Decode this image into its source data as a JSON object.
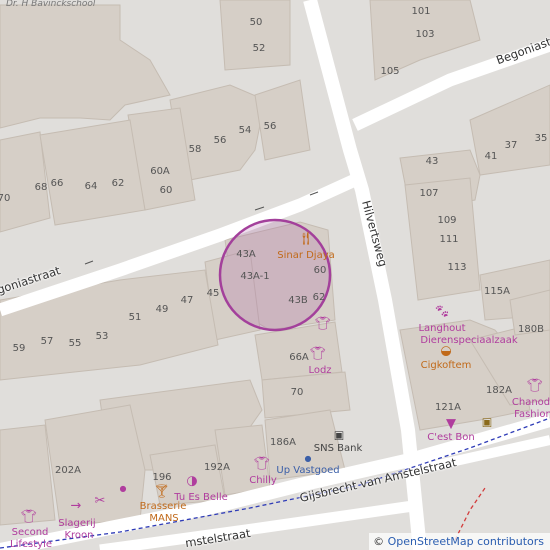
{
  "map": {
    "colors": {
      "background": "#e0dedb",
      "building": "#d6cfc7",
      "building_stroke": "#c5bcb2",
      "road": "#ffffff",
      "highlight_circle": "#a3409b",
      "poi_purple": "#b03d9e",
      "poi_orange": "#c16a1a",
      "route_blue": "#2f3cb7",
      "route_red": "#d23c3c"
    },
    "school_label": "Dr. H Bavinckschool",
    "streets": {
      "hilvertsweg": "Hilvertsweg",
      "begonia_top": "Begoniastr",
      "begonia_left": "goniastraat",
      "gijsbrecht": "Gijsbrecht van Amstelstraat",
      "amstel_bottom": "mstelstraat"
    },
    "house_numbers": {
      "n50": "50",
      "n52": "52",
      "n101": "101",
      "n103": "103",
      "n105": "105",
      "n54": "54",
      "n56a": "56",
      "n56b": "56",
      "n58": "58",
      "n60a": "60A",
      "n60": "60",
      "n62": "62",
      "n64": "64",
      "n66": "66",
      "n68": "68",
      "n70": "70",
      "n43": "43",
      "n41": "41",
      "n37": "37",
      "n35": "35",
      "n107": "107",
      "n109": "109",
      "n111": "111",
      "n113": "113",
      "n115a": "115A",
      "n43a": "43A",
      "n43a1": "43A-1",
      "n60b": "60",
      "n43b": "43B",
      "n62b": "62",
      "n45": "45",
      "n47": "47",
      "n49": "49",
      "n51": "51",
      "n53": "53",
      "n55": "55",
      "n57": "57",
      "n59": "59",
      "n66a": "66A",
      "n70b": "70",
      "n180b": "180B",
      "n182a": "182A",
      "n121a": "121A",
      "n186a": "186A",
      "n192a": "192A",
      "n196": "196",
      "n202a": "202A"
    },
    "pois": {
      "sinar_djaya": "Sinar Djaya",
      "lodz": "Lodz",
      "langhout": "Langhout",
      "dierenspeciaalzaak": "Dierenspeciaalzaak",
      "cigkoftem": "Cigkoftem",
      "chanod": "Chanod",
      "fashion": "Fashion",
      "cest_bon": "C'est Bon",
      "sns_bank": "SNS Bank",
      "up_vastgoed": "Up Vastgoed",
      "chilly": "Chilly",
      "tu_es_belle": "Tu Es Belle",
      "brasserie": "Brasserie",
      "mans": "MANS",
      "slagerij": "Slagerij",
      "kroon": "Kroon",
      "second": "Second",
      "lifestyle": "Lifestyle"
    },
    "icons": {
      "restaurant": "fork-knife-icon",
      "clothes": "shirt-icon",
      "pet": "paw-icon",
      "fast_food": "burger-icon",
      "beauty": "hairdresser-icon",
      "bank": "bank-note-icon",
      "bar": "cocktail-icon",
      "butcher": "knife-icon",
      "office": "office-dot-icon"
    },
    "attribution": {
      "symbol": "©",
      "text": "OpenStreetMap contributors"
    }
  }
}
